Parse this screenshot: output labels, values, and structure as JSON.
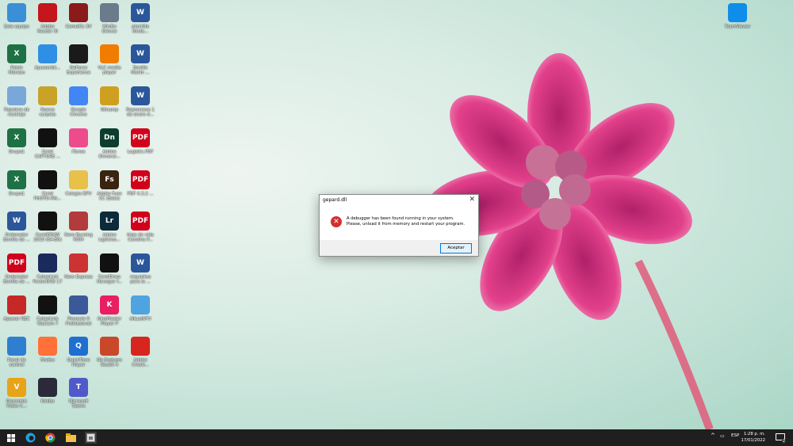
{
  "desktop": {
    "icons": [
      {
        "label": "Este equipo",
        "glyph": "",
        "color": "#3b8fd6"
      },
      {
        "label": "Adobe\nReader XI",
        "glyph": "",
        "color": "#c4161c"
      },
      {
        "label": "CamelCs 3V",
        "glyph": "",
        "color": "#8b1a1a"
      },
      {
        "label": "WinBa\nDeluxe",
        "glyph": "",
        "color": "#6b7b8c"
      },
      {
        "label": "plantilla\nbloda...",
        "glyph": "W",
        "color": "#2b579a"
      },
      {
        "label": "Patoh\nMenezo",
        "glyph": "X",
        "color": "#1e7145"
      },
      {
        "label": "Apowerbit...",
        "glyph": "",
        "color": "#2f8fe5"
      },
      {
        "label": "GeForce\nExperience",
        "glyph": "",
        "color": "#1a1a1a"
      },
      {
        "label": "VLC media\nplayer",
        "glyph": "",
        "color": "#f07d00"
      },
      {
        "label": "Bonilla\nMarlin ...",
        "glyph": "W",
        "color": "#2b579a"
      },
      {
        "label": "Papelera de\nreciclaje",
        "glyph": "",
        "color": "#7aa7d9"
      },
      {
        "label": "Nueva\ncarpeta",
        "glyph": "",
        "color": "#c9a227"
      },
      {
        "label": "Google\nChrome",
        "glyph": "",
        "color": "#4285f4"
      },
      {
        "label": "Winamp",
        "glyph": "",
        "color": "#cfa020"
      },
      {
        "label": "Reprocesos 1\nde enero d...",
        "glyph": "W",
        "color": "#2b579a"
      },
      {
        "label": "Grupo1",
        "glyph": "X",
        "color": "#1e7145"
      },
      {
        "label": "Corel\nCAPTURE ...",
        "glyph": "",
        "color": "#111111"
      },
      {
        "label": "iTunes",
        "glyph": "",
        "color": "#ee4b8c"
      },
      {
        "label": "Adobe\nDimensi...",
        "glyph": "Dn",
        "color": "#0c3d2e"
      },
      {
        "label": "Logistic.PDF",
        "glyph": "PDF",
        "color": "#d0021b"
      },
      {
        "label": "Grupo1",
        "glyph": "X",
        "color": "#1e7145"
      },
      {
        "label": "Corel\nPHOTO-PAI...",
        "glyph": "",
        "color": "#111111"
      },
      {
        "label": "Colegio DPV",
        "glyph": "",
        "color": "#e8c04a"
      },
      {
        "label": "Adobe Fuse\nCC (Beta)",
        "glyph": "Fs",
        "color": "#3a2311"
      },
      {
        "label": "PDF 4.3.2 ...",
        "glyph": "PDF",
        "color": "#d0021b"
      },
      {
        "label": "Ordenador\nBonilla de ...",
        "glyph": "W",
        "color": "#2b579a"
      },
      {
        "label": "CorelDRAW\n2019 (64-Bit)",
        "glyph": "",
        "color": "#111111"
      },
      {
        "label": "Nero Burning\nROM",
        "glyph": "",
        "color": "#b23b3b"
      },
      {
        "label": "Adobe\nLightroo...",
        "glyph": "Lr",
        "color": "#0b2a3a"
      },
      {
        "label": "Hoja de vida\nCarolina P...",
        "glyph": "PDF",
        "color": "#d0021b"
      },
      {
        "label": "Ordenador\nBonilla de ...",
        "glyph": "PDF",
        "color": "#d0021b"
      },
      {
        "label": "CyberLink\nPowerDVD 17",
        "glyph": "",
        "color": "#1b2a5c"
      },
      {
        "label": "Nero Express",
        "glyph": "",
        "color": "#cc3333"
      },
      {
        "label": "CorelDraw\nManager f...",
        "glyph": "",
        "color": "#111111"
      },
      {
        "label": "requisitos\npara la ...",
        "glyph": "W",
        "color": "#2b579a"
      },
      {
        "label": "Apower REC",
        "glyph": "",
        "color": "#c62828"
      },
      {
        "label": "CyberLink\nYouCam 7",
        "glyph": "",
        "color": "#111111"
      },
      {
        "label": "Pinnacle 9\nProfessional",
        "glyph": "",
        "color": "#3b5998"
      },
      {
        "label": "KineMaster\nPlayer P",
        "glyph": "K",
        "color": "#e91e63"
      },
      {
        "label": "AllLedNTV",
        "glyph": "",
        "color": "#4fa3e0"
      },
      {
        "label": "Panel de\ncontrol",
        "glyph": "",
        "color": "#2f7fd1"
      },
      {
        "label": "Firefox",
        "glyph": "",
        "color": "#ff7139"
      },
      {
        "label": "QuickTime\nPlayer",
        "glyph": "Q",
        "color": "#1f6fd1"
      },
      {
        "label": "Nb Bodypro\nStudio 4",
        "glyph": "",
        "color": "#c9482a"
      },
      {
        "label": "Adobe\nCreati...",
        "glyph": "",
        "color": "#d7261e"
      },
      {
        "label": "Descomic\nVideo C...",
        "glyph": "V",
        "color": "#e8a317"
      },
      {
        "label": "Kinibo",
        "glyph": "",
        "color": "#2a2a3a"
      },
      {
        "label": "Microsoft\nTeams",
        "glyph": "T",
        "color": "#5059c9"
      },
      {
        "label": "TeamViewer",
        "glyph": "",
        "color": "#0e8ee9"
      }
    ]
  },
  "dialog": {
    "title": "gepard.dll",
    "close": "✕",
    "error_glyph": "✕",
    "message_line1": "A debugger has been found running in your system.",
    "message_line2": "Please, unload it from memory and restart your program.",
    "button": "Aceptar"
  },
  "taskbar": {
    "language": "ESP",
    "time": "1:28 p. m.",
    "date": "17/01/2022",
    "notification_count": "2"
  }
}
